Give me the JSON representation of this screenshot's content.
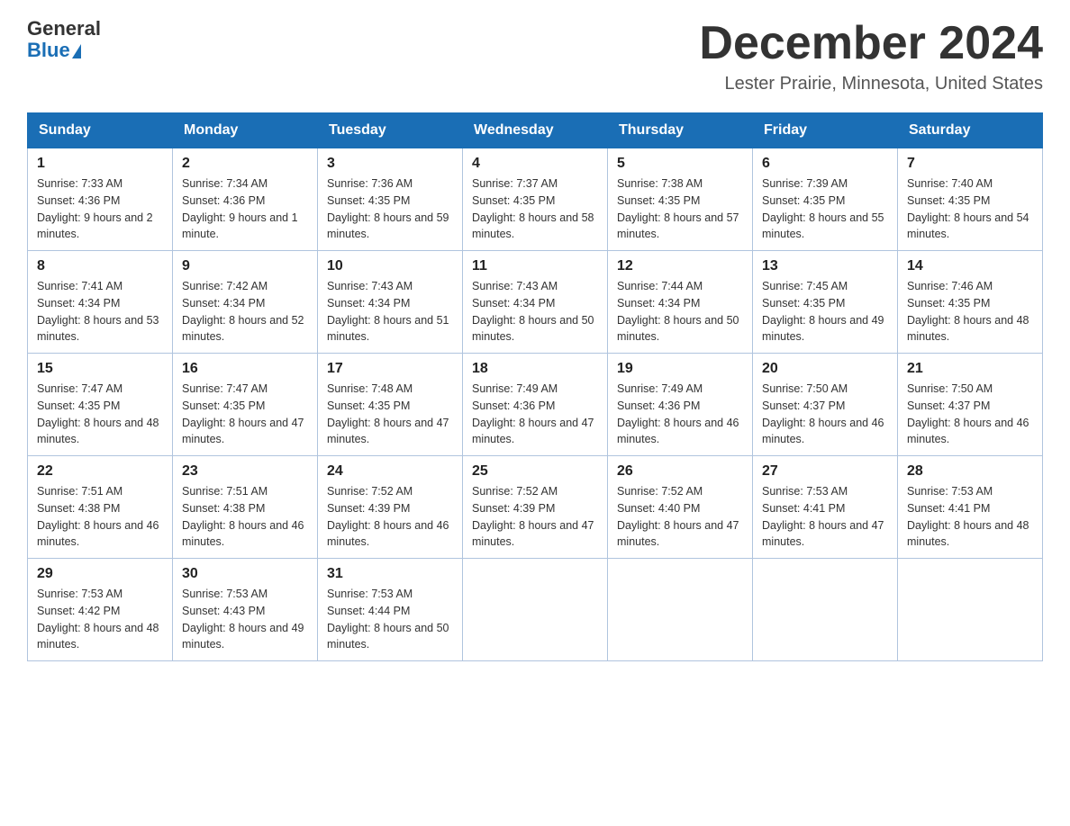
{
  "logo": {
    "general": "General",
    "blue": "Blue"
  },
  "title": "December 2024",
  "location": "Lester Prairie, Minnesota, United States",
  "days_of_week": [
    "Sunday",
    "Monday",
    "Tuesday",
    "Wednesday",
    "Thursday",
    "Friday",
    "Saturday"
  ],
  "weeks": [
    [
      {
        "day": "1",
        "sunrise": "7:33 AM",
        "sunset": "4:36 PM",
        "daylight": "9 hours and 2 minutes."
      },
      {
        "day": "2",
        "sunrise": "7:34 AM",
        "sunset": "4:36 PM",
        "daylight": "9 hours and 1 minute."
      },
      {
        "day": "3",
        "sunrise": "7:36 AM",
        "sunset": "4:35 PM",
        "daylight": "8 hours and 59 minutes."
      },
      {
        "day": "4",
        "sunrise": "7:37 AM",
        "sunset": "4:35 PM",
        "daylight": "8 hours and 58 minutes."
      },
      {
        "day": "5",
        "sunrise": "7:38 AM",
        "sunset": "4:35 PM",
        "daylight": "8 hours and 57 minutes."
      },
      {
        "day": "6",
        "sunrise": "7:39 AM",
        "sunset": "4:35 PM",
        "daylight": "8 hours and 55 minutes."
      },
      {
        "day": "7",
        "sunrise": "7:40 AM",
        "sunset": "4:35 PM",
        "daylight": "8 hours and 54 minutes."
      }
    ],
    [
      {
        "day": "8",
        "sunrise": "7:41 AM",
        "sunset": "4:34 PM",
        "daylight": "8 hours and 53 minutes."
      },
      {
        "day": "9",
        "sunrise": "7:42 AM",
        "sunset": "4:34 PM",
        "daylight": "8 hours and 52 minutes."
      },
      {
        "day": "10",
        "sunrise": "7:43 AM",
        "sunset": "4:34 PM",
        "daylight": "8 hours and 51 minutes."
      },
      {
        "day": "11",
        "sunrise": "7:43 AM",
        "sunset": "4:34 PM",
        "daylight": "8 hours and 50 minutes."
      },
      {
        "day": "12",
        "sunrise": "7:44 AM",
        "sunset": "4:34 PM",
        "daylight": "8 hours and 50 minutes."
      },
      {
        "day": "13",
        "sunrise": "7:45 AM",
        "sunset": "4:35 PM",
        "daylight": "8 hours and 49 minutes."
      },
      {
        "day": "14",
        "sunrise": "7:46 AM",
        "sunset": "4:35 PM",
        "daylight": "8 hours and 48 minutes."
      }
    ],
    [
      {
        "day": "15",
        "sunrise": "7:47 AM",
        "sunset": "4:35 PM",
        "daylight": "8 hours and 48 minutes."
      },
      {
        "day": "16",
        "sunrise": "7:47 AM",
        "sunset": "4:35 PM",
        "daylight": "8 hours and 47 minutes."
      },
      {
        "day": "17",
        "sunrise": "7:48 AM",
        "sunset": "4:35 PM",
        "daylight": "8 hours and 47 minutes."
      },
      {
        "day": "18",
        "sunrise": "7:49 AM",
        "sunset": "4:36 PM",
        "daylight": "8 hours and 47 minutes."
      },
      {
        "day": "19",
        "sunrise": "7:49 AM",
        "sunset": "4:36 PM",
        "daylight": "8 hours and 46 minutes."
      },
      {
        "day": "20",
        "sunrise": "7:50 AM",
        "sunset": "4:37 PM",
        "daylight": "8 hours and 46 minutes."
      },
      {
        "day": "21",
        "sunrise": "7:50 AM",
        "sunset": "4:37 PM",
        "daylight": "8 hours and 46 minutes."
      }
    ],
    [
      {
        "day": "22",
        "sunrise": "7:51 AM",
        "sunset": "4:38 PM",
        "daylight": "8 hours and 46 minutes."
      },
      {
        "day": "23",
        "sunrise": "7:51 AM",
        "sunset": "4:38 PM",
        "daylight": "8 hours and 46 minutes."
      },
      {
        "day": "24",
        "sunrise": "7:52 AM",
        "sunset": "4:39 PM",
        "daylight": "8 hours and 46 minutes."
      },
      {
        "day": "25",
        "sunrise": "7:52 AM",
        "sunset": "4:39 PM",
        "daylight": "8 hours and 47 minutes."
      },
      {
        "day": "26",
        "sunrise": "7:52 AM",
        "sunset": "4:40 PM",
        "daylight": "8 hours and 47 minutes."
      },
      {
        "day": "27",
        "sunrise": "7:53 AM",
        "sunset": "4:41 PM",
        "daylight": "8 hours and 47 minutes."
      },
      {
        "day": "28",
        "sunrise": "7:53 AM",
        "sunset": "4:41 PM",
        "daylight": "8 hours and 48 minutes."
      }
    ],
    [
      {
        "day": "29",
        "sunrise": "7:53 AM",
        "sunset": "4:42 PM",
        "daylight": "8 hours and 48 minutes."
      },
      {
        "day": "30",
        "sunrise": "7:53 AM",
        "sunset": "4:43 PM",
        "daylight": "8 hours and 49 minutes."
      },
      {
        "day": "31",
        "sunrise": "7:53 AM",
        "sunset": "4:44 PM",
        "daylight": "8 hours and 50 minutes."
      },
      null,
      null,
      null,
      null
    ]
  ]
}
